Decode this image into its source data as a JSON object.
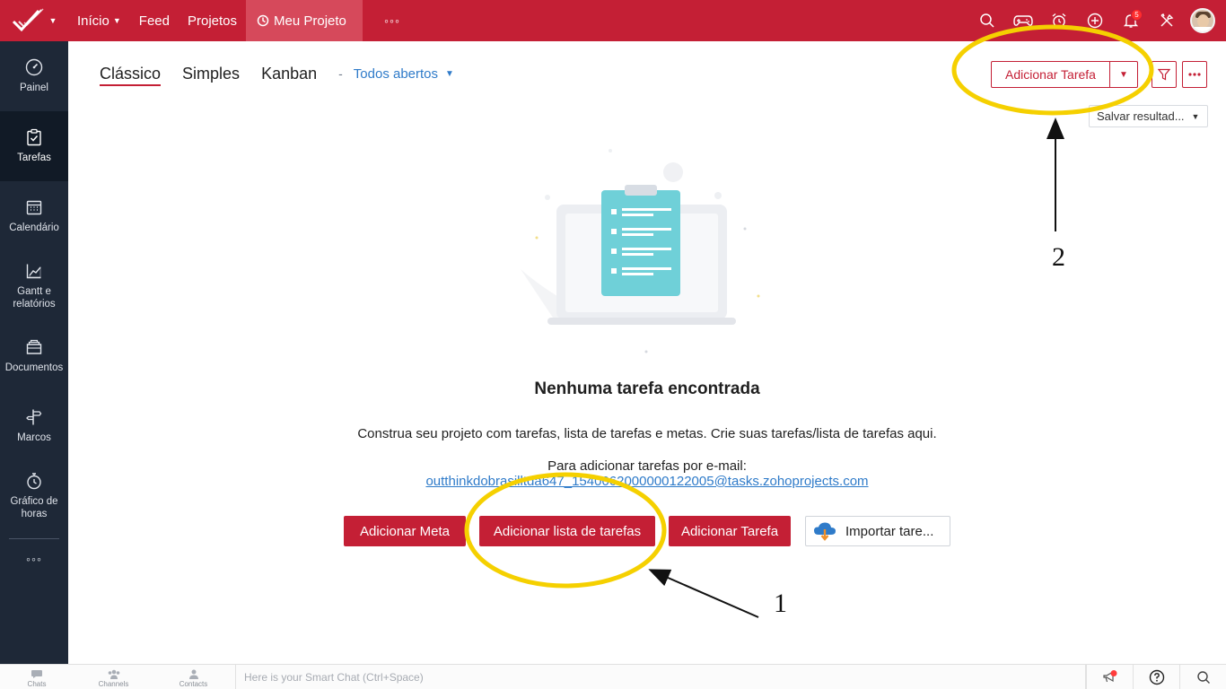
{
  "topbar": {
    "nav": [
      {
        "label": "Início",
        "has_caret": true
      },
      {
        "label": "Feed"
      },
      {
        "label": "Projetos"
      }
    ],
    "active_project": "Meu Projeto",
    "more_dots": "◦◦◦",
    "notification_count": "5",
    "icons": [
      "search-icon",
      "gamepad-icon",
      "alarm-icon",
      "add-icon",
      "bell-icon",
      "tools-icon"
    ],
    "brand_color": "#c41f35"
  },
  "sidebar": {
    "items": [
      {
        "label": "Painel",
        "icon": "dashboard-icon"
      },
      {
        "label": "Tarefas",
        "icon": "tasks-icon",
        "active": true
      },
      {
        "label": "Calendário",
        "icon": "calendar-icon"
      },
      {
        "label": "Gantt e relatórios",
        "icon": "gantt-icon"
      },
      {
        "label": "Documentos",
        "icon": "documents-icon"
      },
      {
        "label": "Marcos",
        "icon": "milestone-icon"
      },
      {
        "label": "Gráfico de horas",
        "icon": "timer-icon"
      }
    ],
    "more": "◦◦◦",
    "bg_color": "#1e2837"
  },
  "views": {
    "tabs": [
      "Clássico",
      "Simples",
      "Kanban"
    ],
    "separator": "-",
    "filter": "Todos abertos"
  },
  "toolbar": {
    "add_task": "Adicionar Tarefa",
    "save_results": "Salvar resultad..."
  },
  "empty_state": {
    "title": "Nenhuma tarefa encontrada",
    "description": "Construa seu projeto com tarefas, lista de tarefas e metas. Crie suas tarefas/lista de tarefas aqui.",
    "email_label": "Para adicionar tarefas por e-mail:",
    "email": "outthinkdobrasilltda647_1540062000000122005@tasks.zohoprojects.com",
    "buttons": {
      "add_goal": "Adicionar Meta",
      "add_tasklist": "Adicionar lista de tarefas",
      "add_task": "Adicionar Tarefa",
      "import": "Importar tare..."
    }
  },
  "annotations": {
    "label_1": "1",
    "label_2": "2",
    "highlight_color": "#f5d000"
  },
  "bottombar": {
    "items": [
      "Chats",
      "Channels",
      "Contacts"
    ],
    "smart_chat_placeholder": "Here is your Smart Chat (Ctrl+Space)"
  }
}
